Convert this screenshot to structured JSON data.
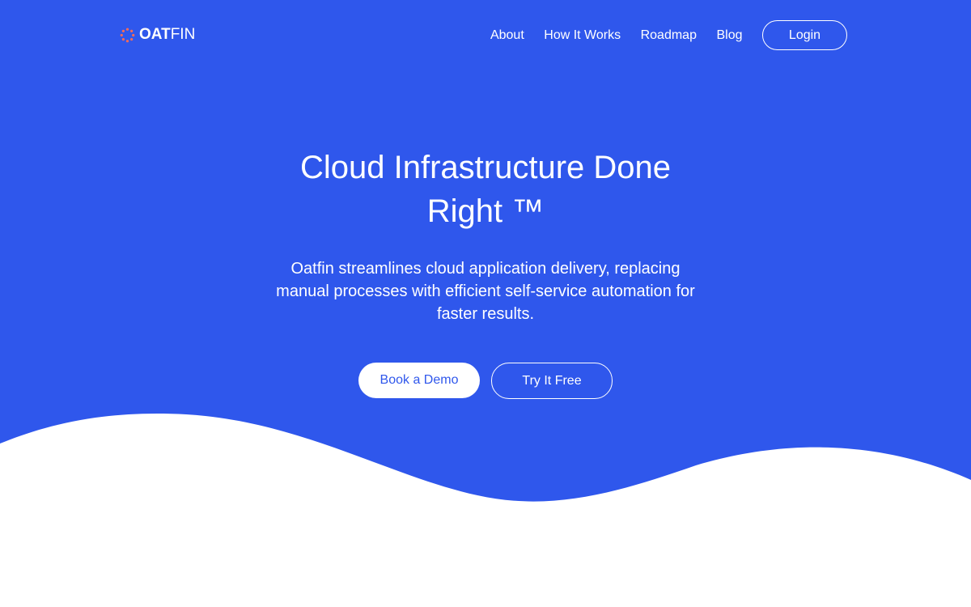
{
  "colors": {
    "brand_blue": "#2f57ec",
    "white": "#ffffff",
    "logo_accent": "#f26b5b"
  },
  "nav": {
    "logo_bold": "OAT",
    "logo_light": "FIN",
    "logo_icon": "dotted-ring-icon",
    "links": [
      "About",
      "How It Works",
      "Roadmap",
      "Blog"
    ],
    "login_label": "Login"
  },
  "hero": {
    "title": "Cloud Infrastructure Done Right ™",
    "subtitle": "Oatfin streamlines cloud application delivery, replacing manual processes with efficient self-service automation for faster results.",
    "primary_cta": "Book a Demo",
    "secondary_cta": "Try It Free"
  }
}
